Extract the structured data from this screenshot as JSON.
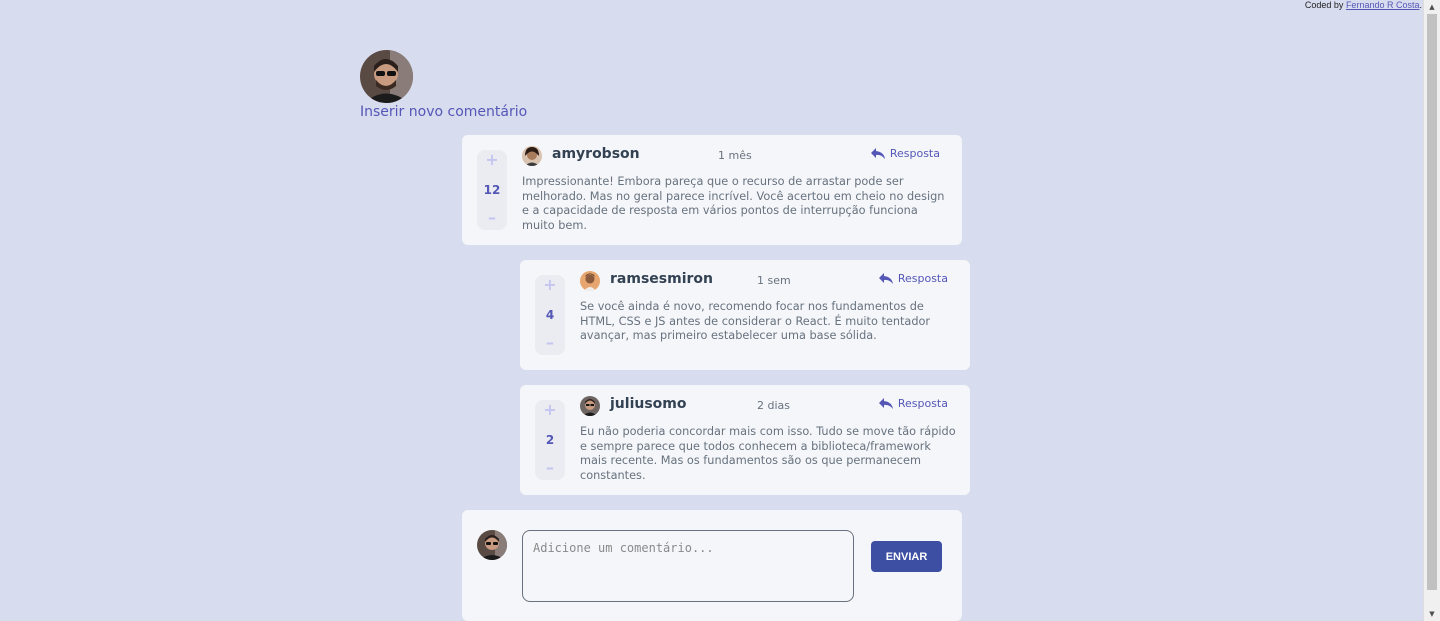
{
  "credit": {
    "prefix": "Coded by ",
    "author": "Fernando R Costa",
    "suffix": "."
  },
  "header": {
    "insert_link": "Inserir novo comentário"
  },
  "comments": [
    {
      "username": "amyrobson",
      "date": "1 mês",
      "score": "12",
      "reply_label": "Resposta",
      "text": "Impressionante! Embora pareça que o recurso de arrastar pode ser melhorado. Mas no geral parece incrível. Você acertou em cheio no design e a capacidade de resposta em vários pontos de interrupção funciona muito bem."
    },
    {
      "username": "ramsesmiron",
      "date": "1 sem",
      "score": "4",
      "reply_label": "Resposta",
      "text": "Se você ainda é novo, recomendo focar nos fundamentos de HTML, CSS e JS antes de considerar o React. É muito tentador avançar, mas primeiro estabelecer uma base sólida."
    },
    {
      "username": "juliusomo",
      "date": "2 dias",
      "score": "2",
      "reply_label": "Resposta",
      "text": "Eu não poderia concordar mais com isso. Tudo se move tão rápido e sempre parece que todos conhecem a biblioteca/framework mais recente. Mas os fundamentos são os que permanecem constantes."
    }
  ],
  "vote": {
    "plus": "+",
    "minus": "–"
  },
  "composer": {
    "placeholder": "Adicione um comentário...",
    "value": "",
    "send_label": "ENVIAR"
  },
  "colors": {
    "background": "#d8dcef",
    "card": "#f5f6fa",
    "accent": "#5457b6",
    "button": "#3d4fa3"
  },
  "icons": {
    "reply": "reply-arrow-icon",
    "avatar": "user-avatar"
  }
}
